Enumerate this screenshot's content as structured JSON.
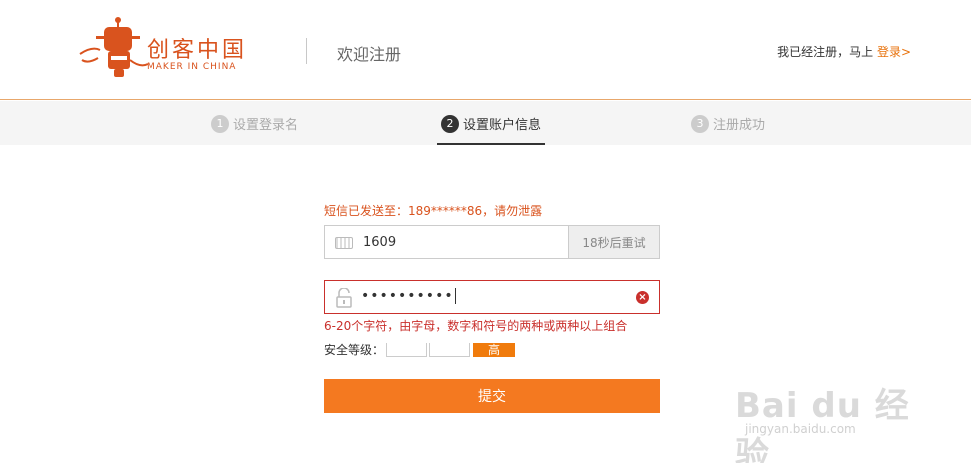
{
  "header": {
    "logo_text": "创客中国",
    "logo_sub": "MAKER IN CHINA",
    "title": "欢迎注册",
    "already_registered": "我已经注册，马上",
    "login_link": "登录>"
  },
  "steps": [
    {
      "num": "1",
      "label": "设置登录名",
      "active": false
    },
    {
      "num": "2",
      "label": "设置账户信息",
      "active": true
    },
    {
      "num": "3",
      "label": "注册成功",
      "active": false
    }
  ],
  "form": {
    "sms_notice": "短信已发送至：189******86，请勿泄露",
    "code_value": "1609",
    "resend_label": "18秒后重试",
    "password_value": "••••••••••",
    "password_hint": "6-20个字符，由字母，数字和符号的两种或两种以上组合",
    "strength_label": "安全等级：",
    "strength_level": "高",
    "submit_label": "提交"
  },
  "watermark": {
    "main": "Bai du 经验",
    "sub": "jingyan.baidu.com"
  },
  "colors": {
    "accent": "#f47920",
    "error": "#c9302c",
    "brand": "#d9531e"
  }
}
